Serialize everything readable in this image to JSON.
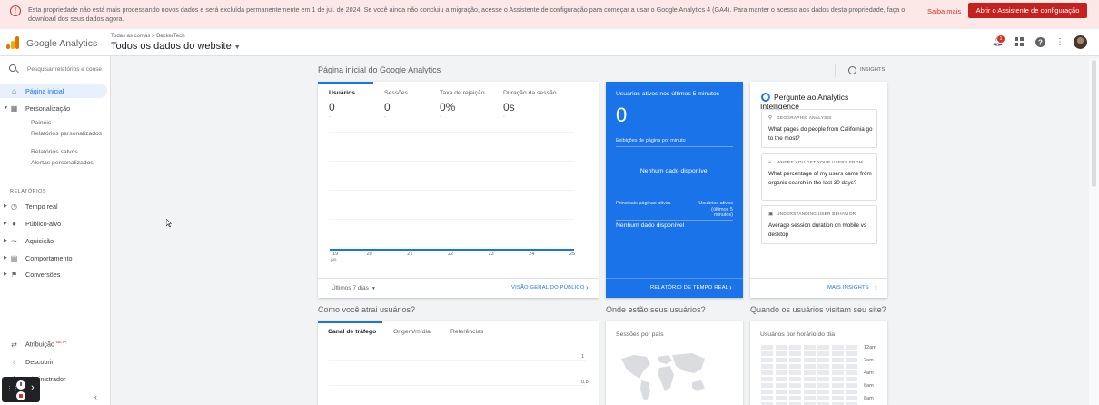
{
  "banner": {
    "text": "Esta propriedade não está mais processando novos dados e será excluída permanentemente em 1 de jul. de 2024. Se você ainda não concluiu a migração, acesse o Assistente de configuração para começar a usar o Google Analytics 4 (GA4). Para manter o acesso aos dados desta propriedade, faça o download dos seus dados agora.",
    "link": "Saiba mais",
    "button": "Abrir o Assistente de configuração",
    "color": "#fce8e6"
  },
  "header": {
    "product": "Google Analytics",
    "breadcrumb": "Todas as contas > BeckerTech",
    "property": "Todos os dados do website",
    "notifications": "1"
  },
  "sidebar": {
    "search_placeholder": "Pesquisar relatórios e conse",
    "items": [
      {
        "label": "Página inicial",
        "icon": "home-icon"
      },
      {
        "label": "Personalização",
        "icon": "dashboard-icon"
      }
    ],
    "custom_sub": [
      "Painéis",
      "Relatórios personalizados",
      "Relatórios salvos",
      "Alertas personalizados"
    ],
    "section": "RELATÓRIOS",
    "reports": [
      {
        "label": "Tempo real",
        "icon": "clock-icon"
      },
      {
        "label": "Público-alvo",
        "icon": "person-icon"
      },
      {
        "label": "Aquisição",
        "icon": "acquisition-icon"
      },
      {
        "label": "Comportamento",
        "icon": "behavior-icon"
      },
      {
        "label": "Conversões",
        "icon": "flag-icon"
      }
    ],
    "bottom": [
      {
        "label": "Atribuição",
        "badge": "BETA",
        "icon": "attribution-icon"
      },
      {
        "label": "Descobrir",
        "icon": "lightbulb-icon"
      },
      {
        "label": "Administrador",
        "icon": "gear-icon"
      }
    ]
  },
  "main": {
    "title": "Página inicial do Google Analytics",
    "insights": "INSIGHTS",
    "metrics": [
      {
        "name": "Usuários",
        "value": "0",
        "delta": "-"
      },
      {
        "name": "Sessões",
        "value": "0",
        "delta": "-"
      },
      {
        "name": "Taxa de rejeição",
        "value": "0%",
        "delta": "-"
      },
      {
        "name": "Duração da sessão",
        "value": "0s",
        "delta": "-"
      }
    ],
    "period": "Últimos 7 dias",
    "audience_link": "VISÃO GERAL DO PÚBLICO"
  },
  "chart_data": {
    "type": "line",
    "categories": [
      "19",
      "20",
      "21",
      "22",
      "23",
      "24",
      "25"
    ],
    "x_month_label": "jun.",
    "series": [
      {
        "values": [
          0,
          0,
          0,
          0,
          0,
          0,
          0
        ]
      }
    ],
    "grid": true
  },
  "realtime": {
    "title": "Usuários ativos nos últimos 5 minutos",
    "count": "0",
    "subtitle": "Exibições de página por minuto",
    "no_data": "Nenhum dado disponível",
    "pages_label": "Principais páginas ativas",
    "active_label": "Usuários ativos (últimos 5 minutos)",
    "no_data2": "Nenhum dado disponível",
    "link": "RELATÓRIO DE TEMPO REAL",
    "color": "#1a73e8"
  },
  "intelligence": {
    "title": "Pergunte ao Analytics Intelligence",
    "questions": [
      {
        "category": "GEOGRAPHIC ANALYSIS",
        "text": "What pages do people from California go to the most?"
      },
      {
        "category": "WHERE YOU GET YOUR USERS FROM",
        "text": "What percentage of my users came from organic search in the last 30 days?"
      },
      {
        "category": "UNDERSTANDING USER BEHAVIOR",
        "text": "Average session duration on mobile vs desktop"
      }
    ],
    "link": "MAIS INSIGHTS"
  },
  "acquisition": {
    "title": "Como você atrai usuários?",
    "tabs": [
      "Canal de tráfego",
      "Origem/mídia",
      "Referências"
    ],
    "y_labels": [
      "1",
      "0.8"
    ]
  },
  "geo": {
    "title": "Onde estão seus usuários?",
    "subtitle": "Sessões por país"
  },
  "time": {
    "title": "Quando os usuários visitam seu site?",
    "subtitle": "Usuários por horário do dia",
    "hours": [
      "12am",
      "2am",
      "4am",
      "6am",
      "8am"
    ]
  }
}
